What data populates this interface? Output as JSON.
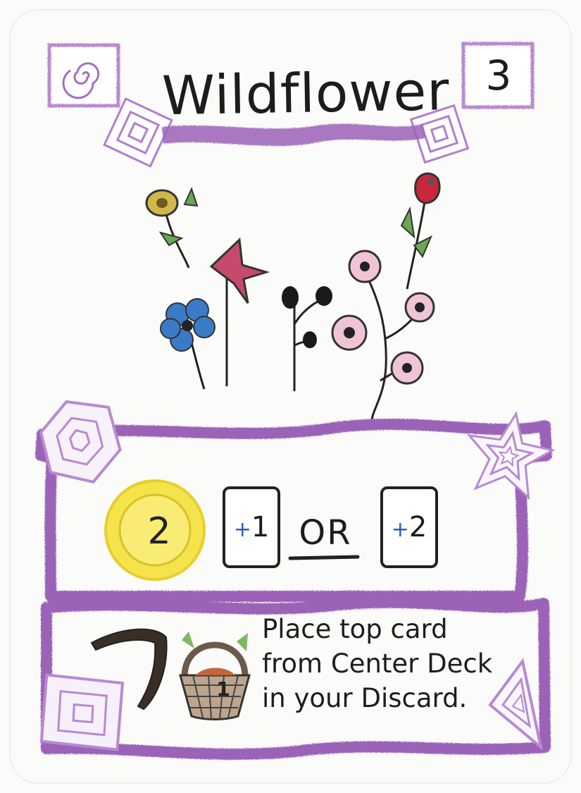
{
  "card": {
    "title": "Wildflower",
    "cost": "3",
    "reward": {
      "coin_value": "2",
      "option_a": {
        "prefix": "+",
        "number": "1"
      },
      "connector": "OR",
      "option_b": {
        "prefix": "+",
        "number": "2"
      }
    },
    "ability": {
      "basket_value": "1",
      "lines": [
        "Place top card",
        "from Center Deck",
        "in your Discard."
      ]
    }
  },
  "colors": {
    "border_purple": "#9b62b8",
    "light_purple": "#c9a2dc",
    "coin_yellow": "#f4e34a",
    "blue_plus": "#2a5db8"
  },
  "icons": [
    "spiral-icon",
    "square-spiral-icon",
    "hexagon-spiral-icon",
    "star-icon",
    "diamond-spiral-icon",
    "triangle-spiral-icon",
    "coin-icon",
    "card-icon",
    "sickle-icon",
    "basket-icon",
    "flowers-illustration"
  ]
}
